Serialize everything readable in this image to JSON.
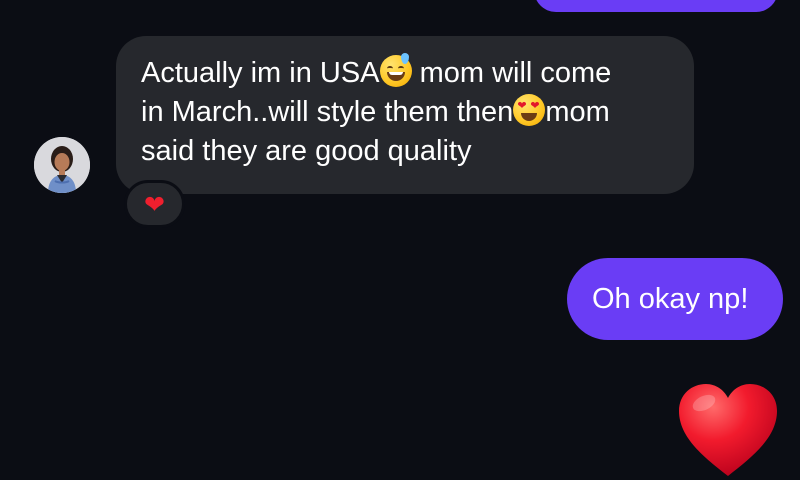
{
  "colors": {
    "background": "#0b0d14",
    "incoming_bubble": "#26282d",
    "outgoing_bubble": "#6a3df5",
    "heart": "#ef1f2e"
  },
  "messages": {
    "incoming": {
      "line1_before_emoji": "Actually im in USA",
      "line1_emoji": "grinning-sweat-emoji",
      "line1_after_emoji": " mom will come",
      "line2_before_emoji": "in March..will style them then",
      "line2_emoji": "heart-eyes-emoji",
      "line2_after_emoji": "mom",
      "line3": "said they are good quality",
      "reaction": "❤",
      "reaction_icon": "red-heart-icon"
    },
    "outgoing": {
      "text": "Oh okay np!"
    },
    "outgoing_emoji_icon": "large-red-heart-icon"
  }
}
